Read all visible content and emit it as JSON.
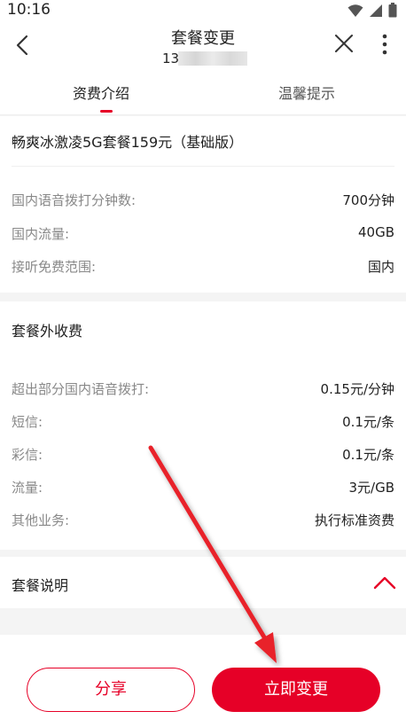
{
  "status_bar": {
    "time": "10:16"
  },
  "header": {
    "title": "套餐变更",
    "phone_visible_prefix": "13",
    "icons": {
      "back": "chevron-left-icon",
      "close": "close-icon",
      "more": "more-vertical-icon"
    }
  },
  "tabs": [
    {
      "label": "资费介绍",
      "active": true
    },
    {
      "label": "温馨提示",
      "active": false
    }
  ],
  "plan": {
    "name": "畅爽冰激凌5G套餐159元（基础版）",
    "rows": [
      {
        "label": "国内语音拨打分钟数:",
        "value": "700分钟"
      },
      {
        "label": "国内流量:",
        "value": "40GB"
      },
      {
        "label": "接听免费范围:",
        "value": "国内"
      }
    ]
  },
  "extra_fees": {
    "title": "套餐外收费",
    "rows": [
      {
        "label": "超出部分国内语音拨打:",
        "value": "0.15元/分钟"
      },
      {
        "label": "短信:",
        "value": "0.1元/条"
      },
      {
        "label": "彩信:",
        "value": "0.1元/条"
      },
      {
        "label": "流量:",
        "value": "3元/GB"
      },
      {
        "label": "其他业务:",
        "value": "执行标准资费"
      }
    ]
  },
  "description": {
    "title": "套餐说明",
    "expanded": true,
    "icon": "chevron-up-icon"
  },
  "actions": {
    "share_label": "分享",
    "change_label": "立即变更"
  },
  "colors": {
    "accent": "#e60027",
    "background": "#f4f4f4",
    "label_gray": "#888888"
  }
}
